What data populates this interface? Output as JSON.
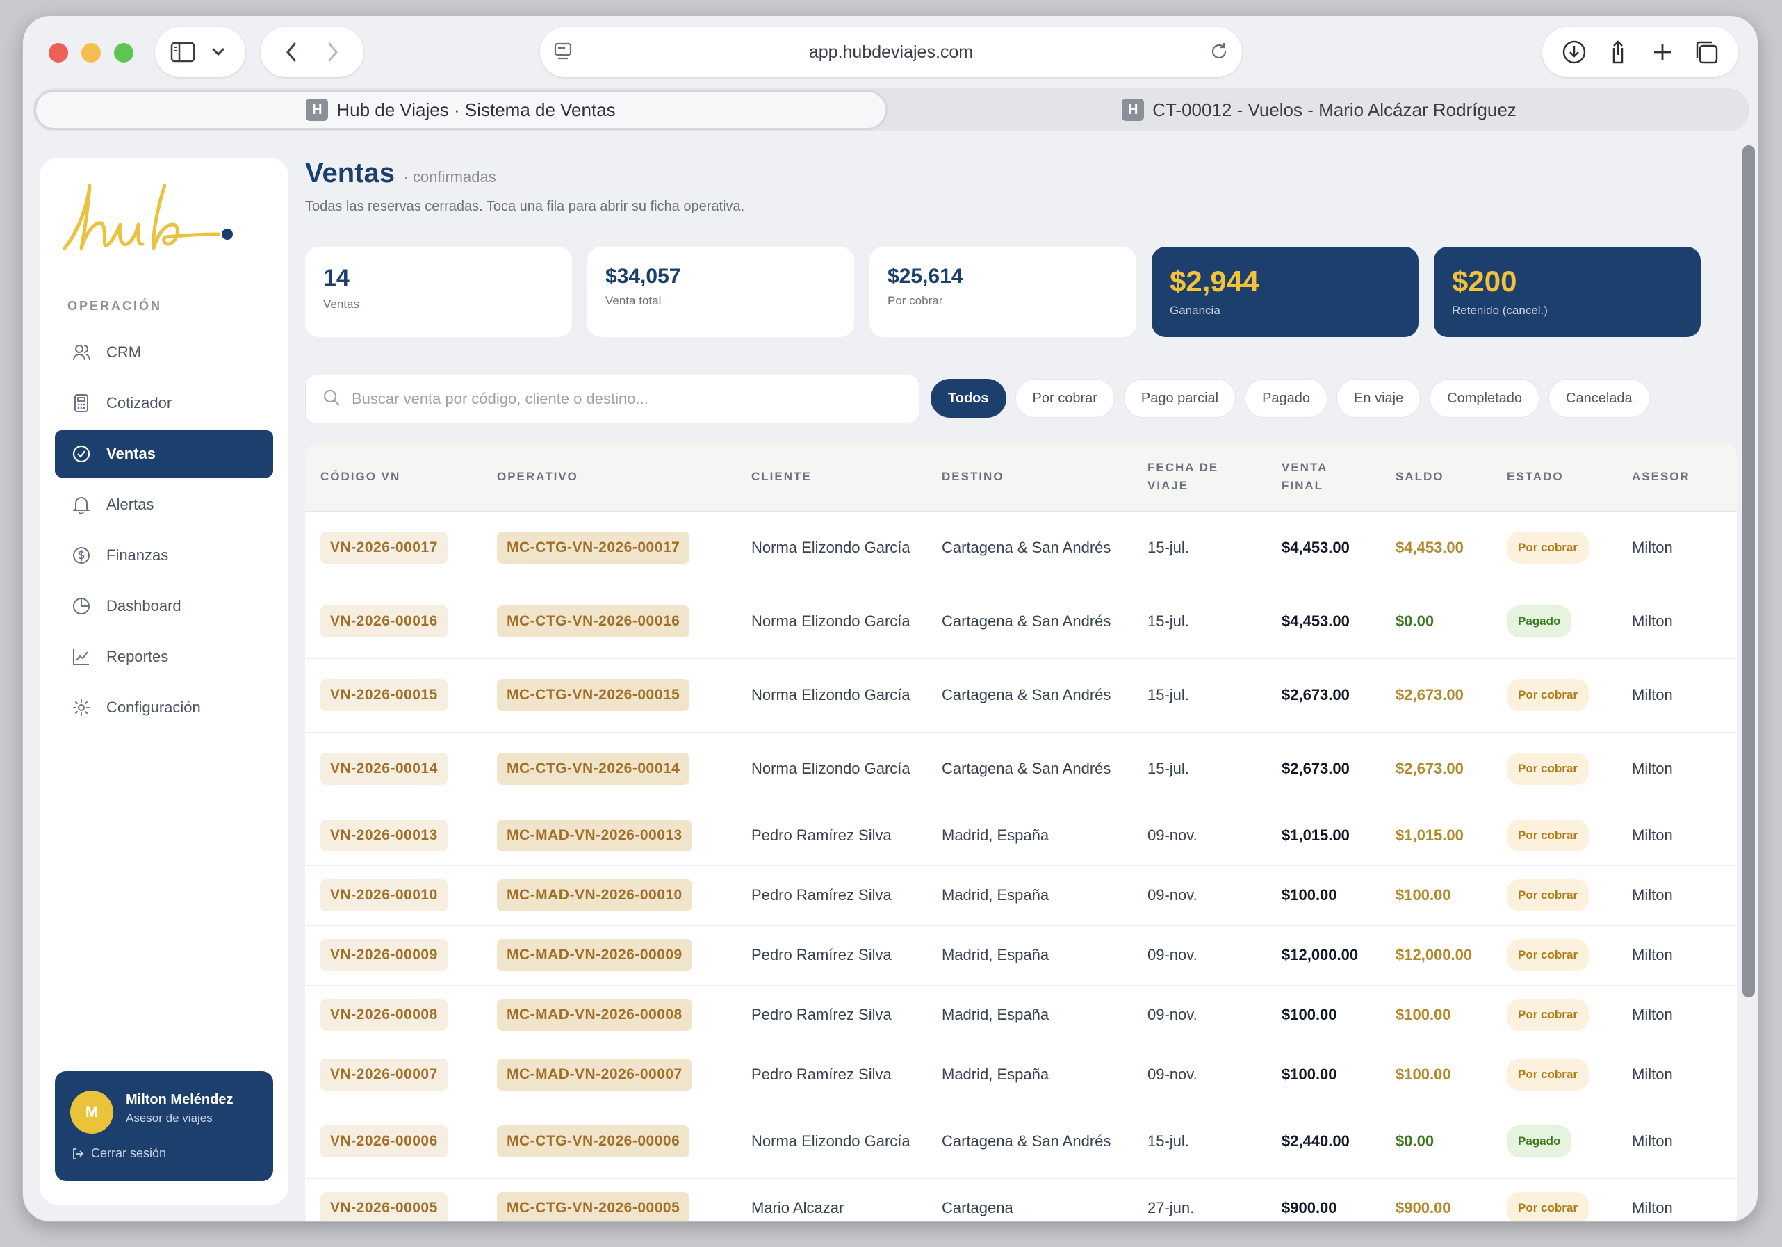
{
  "browser": {
    "url": "app.hubdeviajes.com",
    "tabs": [
      {
        "label": "Hub de Viajes · Sistema de Ventas",
        "favicon": "H",
        "active": true
      },
      {
        "label": "CT-00012 - Vuelos - Mario Alcázar Rodríguez",
        "favicon": "H",
        "active": false
      }
    ]
  },
  "sidebar": {
    "logo_text": "hub",
    "section_label": "OPERACIÓN",
    "items": [
      {
        "label": "CRM",
        "icon": "users-icon"
      },
      {
        "label": "Cotizador",
        "icon": "calculator-icon"
      },
      {
        "label": "Ventas",
        "icon": "check-circle-icon",
        "active": true
      },
      {
        "label": "Alertas",
        "icon": "bell-icon"
      },
      {
        "label": "Finanzas",
        "icon": "dollar-circle-icon"
      },
      {
        "label": "Dashboard",
        "icon": "pie-chart-icon"
      },
      {
        "label": "Reportes",
        "icon": "line-chart-icon"
      },
      {
        "label": "Configuración",
        "icon": "gear-icon"
      }
    ],
    "user": {
      "initial": "M",
      "name": "Milton Meléndez",
      "role": "Asesor de viajes",
      "logout": "Cerrar sesión"
    }
  },
  "page": {
    "title": "Ventas",
    "subtitle": "· confirmadas",
    "description": "Todas las reservas cerradas. Toca una fila para abrir su ficha operativa."
  },
  "stats": [
    {
      "value": "14",
      "label": "Ventas"
    },
    {
      "value": "$34,057",
      "label": "Venta total"
    },
    {
      "value": "$25,614",
      "label": "Por cobrar"
    },
    {
      "value": "$2,944",
      "label": "Ganancia"
    },
    {
      "value": "$200",
      "label": "Retenido (cancel.)"
    }
  ],
  "search": {
    "placeholder": "Buscar venta por código, cliente o destino..."
  },
  "filters": [
    "Todos",
    "Por cobrar",
    "Pago parcial",
    "Pagado",
    "En viaje",
    "Completado",
    "Cancelada"
  ],
  "table": {
    "headers": {
      "codigo": "CÓDIGO VN",
      "operativo": "OPERATIVO",
      "cliente": "CLIENTE",
      "destino": "DESTINO",
      "fecha": "FECHA DE VIAJE",
      "venta": "VENTA FINAL",
      "saldo": "SALDO",
      "estado": "ESTADO",
      "asesor": "ASESOR"
    },
    "rows": [
      {
        "codigo": "VN-2026-00017",
        "operativo": "MC-CTG-VN-2026-00017",
        "cliente": "Norma Elizondo García",
        "destino": "Cartagena & San Andrés",
        "fecha": "15-jul.",
        "venta": "$4,453.00",
        "saldo": "$4,453.00",
        "estado": "Por cobrar",
        "asesor": "Milton"
      },
      {
        "codigo": "VN-2026-00016",
        "operativo": "MC-CTG-VN-2026-00016",
        "cliente": "Norma Elizondo García",
        "destino": "Cartagena & San Andrés",
        "fecha": "15-jul.",
        "venta": "$4,453.00",
        "saldo": "$0.00",
        "estado": "Pagado",
        "asesor": "Milton"
      },
      {
        "codigo": "VN-2026-00015",
        "operativo": "MC-CTG-VN-2026-00015",
        "cliente": "Norma Elizondo García",
        "destino": "Cartagena & San Andrés",
        "fecha": "15-jul.",
        "venta": "$2,673.00",
        "saldo": "$2,673.00",
        "estado": "Por cobrar",
        "asesor": "Milton"
      },
      {
        "codigo": "VN-2026-00014",
        "operativo": "MC-CTG-VN-2026-00014",
        "cliente": "Norma Elizondo García",
        "destino": "Cartagena & San Andrés",
        "fecha": "15-jul.",
        "venta": "$2,673.00",
        "saldo": "$2,673.00",
        "estado": "Por cobrar",
        "asesor": "Milton"
      },
      {
        "codigo": "VN-2026-00013",
        "operativo": "MC-MAD-VN-2026-00013",
        "cliente": "Pedro Ramírez Silva",
        "destino": "Madrid, España",
        "fecha": "09-nov.",
        "venta": "$1,015.00",
        "saldo": "$1,015.00",
        "estado": "Por cobrar",
        "asesor": "Milton"
      },
      {
        "codigo": "VN-2026-00010",
        "operativo": "MC-MAD-VN-2026-00010",
        "cliente": "Pedro Ramírez Silva",
        "destino": "Madrid, España",
        "fecha": "09-nov.",
        "venta": "$100.00",
        "saldo": "$100.00",
        "estado": "Por cobrar",
        "asesor": "Milton"
      },
      {
        "codigo": "VN-2026-00009",
        "operativo": "MC-MAD-VN-2026-00009",
        "cliente": "Pedro Ramírez Silva",
        "destino": "Madrid, España",
        "fecha": "09-nov.",
        "venta": "$12,000.00",
        "saldo": "$12,000.00",
        "estado": "Por cobrar",
        "asesor": "Milton"
      },
      {
        "codigo": "VN-2026-00008",
        "operativo": "MC-MAD-VN-2026-00008",
        "cliente": "Pedro Ramírez Silva",
        "destino": "Madrid, España",
        "fecha": "09-nov.",
        "venta": "$100.00",
        "saldo": "$100.00",
        "estado": "Por cobrar",
        "asesor": "Milton"
      },
      {
        "codigo": "VN-2026-00007",
        "operativo": "MC-MAD-VN-2026-00007",
        "cliente": "Pedro Ramírez Silva",
        "destino": "Madrid, España",
        "fecha": "09-nov.",
        "venta": "$100.00",
        "saldo": "$100.00",
        "estado": "Por cobrar",
        "asesor": "Milton"
      },
      {
        "codigo": "VN-2026-00006",
        "operativo": "MC-CTG-VN-2026-00006",
        "cliente": "Norma Elizondo García",
        "destino": "Cartagena & San Andrés",
        "fecha": "15-jul.",
        "venta": "$2,440.00",
        "saldo": "$0.00",
        "estado": "Pagado",
        "asesor": "Milton"
      },
      {
        "codigo": "VN-2026-00005",
        "operativo": "MC-CTG-VN-2026-00005",
        "cliente": "Mario Alcazar",
        "destino": "Cartagena",
        "fecha": "27-jun.",
        "venta": "$900.00",
        "saldo": "$900.00",
        "estado": "Por cobrar",
        "asesor": "Milton"
      }
    ]
  },
  "colors": {
    "primary": "#1c3f6e",
    "accent": "#f2c23a",
    "due": "#b08a2a",
    "paid": "#3d7a1f"
  }
}
